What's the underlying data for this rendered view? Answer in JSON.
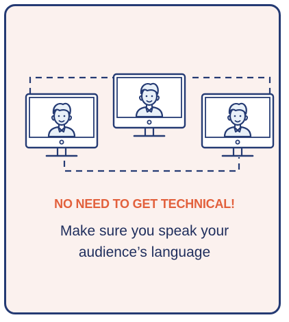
{
  "card": {
    "headline": "NO NEED TO GET TECHNICAL!",
    "subtext_line1": "Make sure you speak your",
    "subtext_line2": "audience’s language"
  },
  "illustration": {
    "monitors": [
      "left-monitor",
      "center-monitor",
      "right-monitor"
    ],
    "icon_names": [
      "monitor-icon",
      "person-avatar-icon",
      "dashed-connection"
    ]
  },
  "colors": {
    "border": "#243a73",
    "card_background": "#fbf1ee",
    "accent": "#e2603c",
    "text": "#1e2d5c",
    "avatar_fill": "#e8f0f8"
  }
}
